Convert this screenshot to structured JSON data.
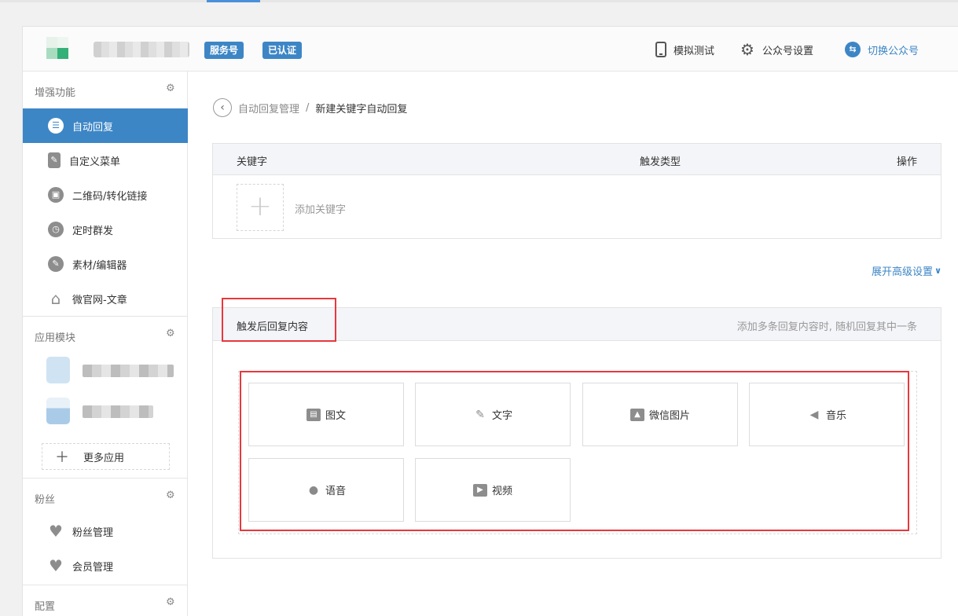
{
  "header": {
    "badges": [
      "服务号",
      "已认证"
    ],
    "simulate_test": "模拟测试",
    "account_settings": "公众号设置",
    "switch_account": "切换公众号"
  },
  "sidebar": {
    "sections": [
      {
        "title": "增强功能",
        "items": [
          {
            "label": "自动回复",
            "icon": "chat-icon",
            "active": true
          },
          {
            "label": "自定义菜单",
            "icon": "document-edit-icon"
          },
          {
            "label": "二维码/转化链接",
            "icon": "qrcode-icon"
          },
          {
            "label": "定时群发",
            "icon": "clock-icon"
          },
          {
            "label": "素材/编辑器",
            "icon": "pencil-icon"
          },
          {
            "label": "微官网-文章",
            "icon": "home-icon"
          }
        ]
      },
      {
        "title": "应用模块",
        "more_apps": "更多应用"
      },
      {
        "title": "粉丝",
        "items": [
          {
            "label": "粉丝管理",
            "icon": "heart-icon"
          },
          {
            "label": "会员管理",
            "icon": "heart-icon"
          }
        ]
      },
      {
        "title": "配置"
      }
    ]
  },
  "breadcrumb": {
    "parent": "自动回复管理",
    "separator": "/",
    "current": "新建关键字自动回复"
  },
  "keyword_table": {
    "columns": [
      "关键字",
      "触发类型",
      "操作"
    ],
    "add_keyword": "添加关键字"
  },
  "advanced_settings": "展开高级设置",
  "reply": {
    "title": "触发后回复内容",
    "hint": "添加多条回复内容时, 随机回复其中一条",
    "types": [
      {
        "label": "图文",
        "icon": "image-text-icon"
      },
      {
        "label": "文字",
        "icon": "pencil-icon"
      },
      {
        "label": "微信图片",
        "icon": "picture-icon"
      },
      {
        "label": "音乐",
        "icon": "speaker-icon"
      },
      {
        "label": "语音",
        "icon": "microphone-icon"
      },
      {
        "label": "视频",
        "icon": "video-icon"
      }
    ]
  },
  "colors": {
    "accent": "#3d86c6",
    "highlight": "#e8383d"
  }
}
